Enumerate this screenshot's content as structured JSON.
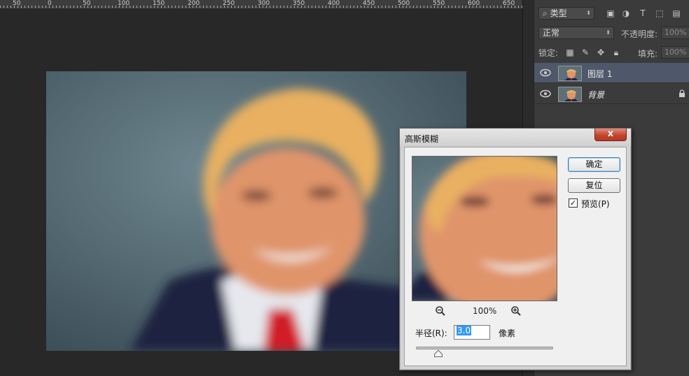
{
  "ruler": {
    "labels": [
      "50",
      "0",
      "50",
      "100",
      "150",
      "200",
      "250",
      "300",
      "350",
      "400",
      "450",
      "500",
      "550",
      "600",
      "650"
    ]
  },
  "layers_panel": {
    "filter_select": "类型",
    "blend_mode": "正常",
    "opacity_label": "不透明度:",
    "opacity_value": "100%",
    "lock_label": "锁定:",
    "fill_label": "填充:",
    "fill_value": "100%",
    "layers": [
      {
        "name": "图层 1",
        "active": true,
        "locked": false
      },
      {
        "name": "背景",
        "active": false,
        "locked": true
      }
    ]
  },
  "dialog": {
    "title": "高斯模糊",
    "close_label": "x",
    "ok_label": "确定",
    "reset_label": "复位",
    "preview_label": "预览(P)",
    "preview_checked": "✓",
    "zoom_level": "100%",
    "radius_label": "半径(R):",
    "radius_value": "3.0",
    "radius_unit": "像素"
  },
  "colors": {
    "accent": "#4f576a",
    "background_wall": "#5b7078",
    "hair": "#e8b060",
    "skin": "#e0946a",
    "suit": "#1c2440",
    "tie": "#d21b25"
  }
}
